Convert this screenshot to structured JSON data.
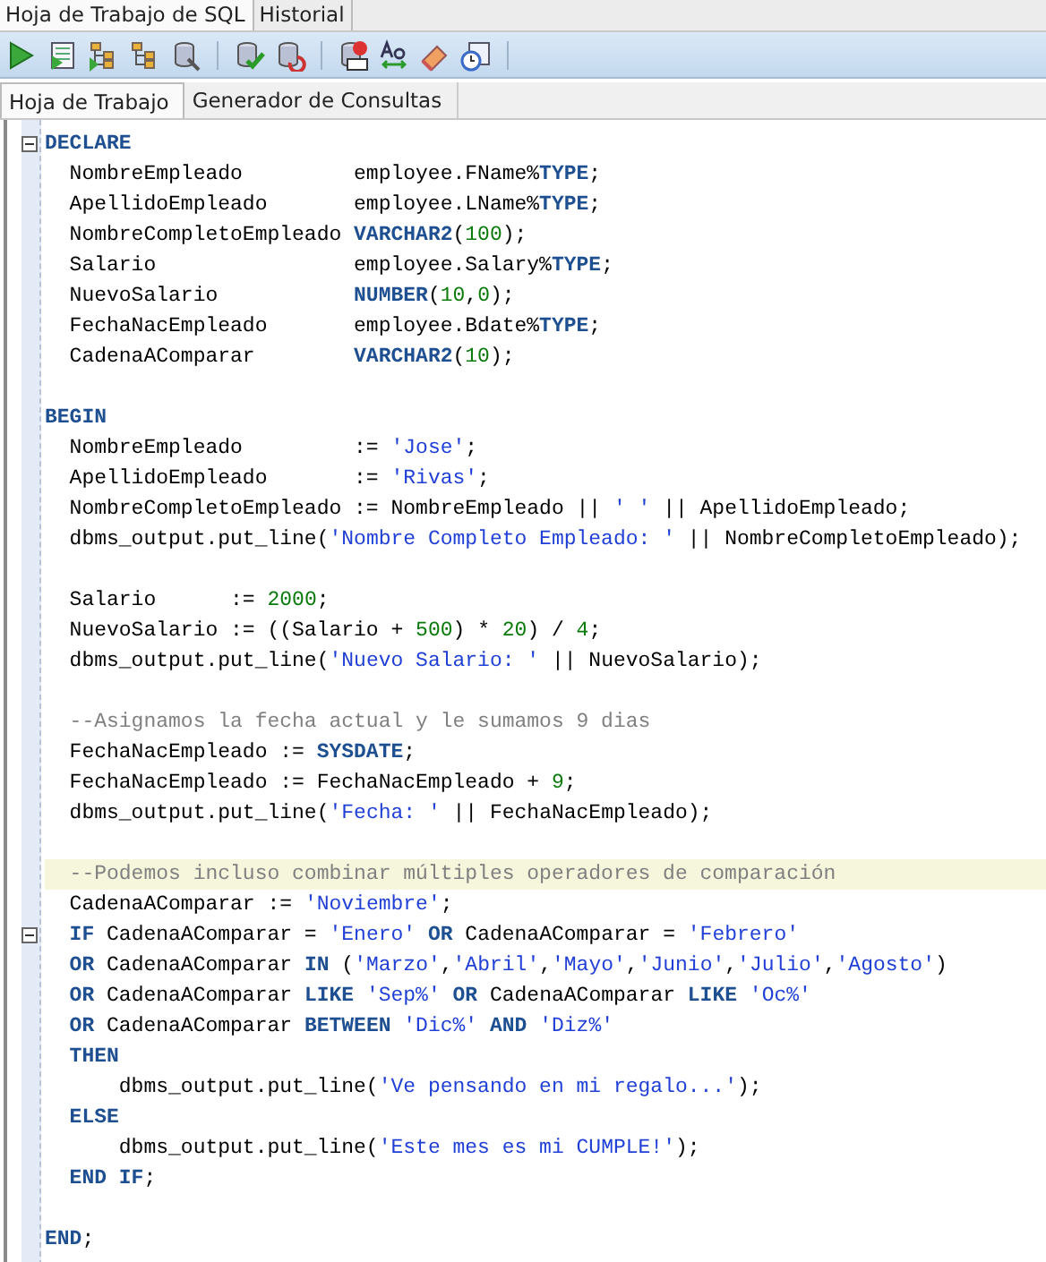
{
  "tabs": [
    {
      "label": "Hoja de Trabajo de SQL",
      "selected": true
    },
    {
      "label": "Historial",
      "selected": false
    }
  ],
  "subtabs": [
    {
      "label": "Hoja de Trabajo",
      "selected": true
    },
    {
      "label": "Generador de Consultas",
      "selected": false
    }
  ],
  "editor": {
    "lines": [
      {
        "kind": "code",
        "fold": true,
        "tokens": [
          {
            "kind": "keyword",
            "text": "DECLARE"
          }
        ]
      },
      {
        "kind": "code",
        "tokens": [
          {
            "kind": "plain",
            "text": "  NombreEmpleado         employee.FName%"
          },
          {
            "kind": "keyword",
            "text": "TYPE"
          },
          {
            "kind": "plain",
            "text": ";"
          }
        ]
      },
      {
        "kind": "code",
        "tokens": [
          {
            "kind": "plain",
            "text": "  ApellidoEmpleado       employee.LName%"
          },
          {
            "kind": "keyword",
            "text": "TYPE"
          },
          {
            "kind": "plain",
            "text": ";"
          }
        ]
      },
      {
        "kind": "code",
        "tokens": [
          {
            "kind": "plain",
            "text": "  NombreCompletoEmpleado "
          },
          {
            "kind": "keyword",
            "text": "VARCHAR2"
          },
          {
            "kind": "plain",
            "text": "("
          },
          {
            "kind": "number",
            "text": "100"
          },
          {
            "kind": "plain",
            "text": ");"
          }
        ]
      },
      {
        "kind": "code",
        "tokens": [
          {
            "kind": "plain",
            "text": "  Salario                employee.Salary%"
          },
          {
            "kind": "keyword",
            "text": "TYPE"
          },
          {
            "kind": "plain",
            "text": ";"
          }
        ]
      },
      {
        "kind": "code",
        "tokens": [
          {
            "kind": "plain",
            "text": "  NuevoSalario           "
          },
          {
            "kind": "keyword",
            "text": "NUMBER"
          },
          {
            "kind": "plain",
            "text": "("
          },
          {
            "kind": "number",
            "text": "10"
          },
          {
            "kind": "plain",
            "text": ","
          },
          {
            "kind": "number",
            "text": "0"
          },
          {
            "kind": "plain",
            "text": ");"
          }
        ]
      },
      {
        "kind": "code",
        "tokens": [
          {
            "kind": "plain",
            "text": "  FechaNacEmpleado       employee.Bdate%"
          },
          {
            "kind": "keyword",
            "text": "TYPE"
          },
          {
            "kind": "plain",
            "text": ";"
          }
        ]
      },
      {
        "kind": "code",
        "tokens": [
          {
            "kind": "plain",
            "text": "  CadenaAComparar        "
          },
          {
            "kind": "keyword",
            "text": "VARCHAR2"
          },
          {
            "kind": "plain",
            "text": "("
          },
          {
            "kind": "number",
            "text": "10"
          },
          {
            "kind": "plain",
            "text": ");"
          }
        ]
      },
      {
        "kind": "blank"
      },
      {
        "kind": "code",
        "tokens": [
          {
            "kind": "keyword",
            "text": "BEGIN"
          }
        ]
      },
      {
        "kind": "code",
        "tokens": [
          {
            "kind": "plain",
            "text": "  NombreEmpleado         := "
          },
          {
            "kind": "string",
            "text": "'Jose'"
          },
          {
            "kind": "plain",
            "text": ";"
          }
        ]
      },
      {
        "kind": "code",
        "tokens": [
          {
            "kind": "plain",
            "text": "  ApellidoEmpleado       := "
          },
          {
            "kind": "string",
            "text": "'Rivas'"
          },
          {
            "kind": "plain",
            "text": ";"
          }
        ]
      },
      {
        "kind": "code",
        "tokens": [
          {
            "kind": "plain",
            "text": "  NombreCompletoEmpleado := NombreEmpleado || "
          },
          {
            "kind": "string",
            "text": "' '"
          },
          {
            "kind": "plain",
            "text": " || ApellidoEmpleado;"
          }
        ]
      },
      {
        "kind": "code",
        "tokens": [
          {
            "kind": "plain",
            "text": "  dbms_output.put_line("
          },
          {
            "kind": "string",
            "text": "'Nombre Completo Empleado: '"
          },
          {
            "kind": "plain",
            "text": " || NombreCompletoEmpleado);"
          }
        ]
      },
      {
        "kind": "blank"
      },
      {
        "kind": "code",
        "tokens": [
          {
            "kind": "plain",
            "text": "  Salario      := "
          },
          {
            "kind": "number",
            "text": "2000"
          },
          {
            "kind": "plain",
            "text": ";"
          }
        ]
      },
      {
        "kind": "code",
        "tokens": [
          {
            "kind": "plain",
            "text": "  NuevoSalario := ((Salario + "
          },
          {
            "kind": "number",
            "text": "500"
          },
          {
            "kind": "plain",
            "text": ") * "
          },
          {
            "kind": "number",
            "text": "20"
          },
          {
            "kind": "plain",
            "text": ") / "
          },
          {
            "kind": "number",
            "text": "4"
          },
          {
            "kind": "plain",
            "text": ";"
          }
        ]
      },
      {
        "kind": "code",
        "tokens": [
          {
            "kind": "plain",
            "text": "  dbms_output.put_line("
          },
          {
            "kind": "string",
            "text": "'Nuevo Salario: '"
          },
          {
            "kind": "plain",
            "text": " || NuevoSalario);"
          }
        ]
      },
      {
        "kind": "blank"
      },
      {
        "kind": "code",
        "tokens": [
          {
            "kind": "comment",
            "text": "  --Asignamos la fecha actual y le sumamos 9 dias"
          }
        ]
      },
      {
        "kind": "code",
        "tokens": [
          {
            "kind": "plain",
            "text": "  FechaNacEmpleado := "
          },
          {
            "kind": "keyword",
            "text": "SYSDATE"
          },
          {
            "kind": "plain",
            "text": ";"
          }
        ]
      },
      {
        "kind": "code",
        "tokens": [
          {
            "kind": "plain",
            "text": "  FechaNacEmpleado := FechaNacEmpleado + "
          },
          {
            "kind": "number",
            "text": "9"
          },
          {
            "kind": "plain",
            "text": ";"
          }
        ]
      },
      {
        "kind": "code",
        "tokens": [
          {
            "kind": "plain",
            "text": "  dbms_output.put_line("
          },
          {
            "kind": "string",
            "text": "'Fecha: '"
          },
          {
            "kind": "plain",
            "text": " || FechaNacEmpleado);"
          }
        ]
      },
      {
        "kind": "blank"
      },
      {
        "kind": "code",
        "highlighted": true,
        "tokens": [
          {
            "kind": "comment",
            "text": "  --Podemos incluso combinar múltiples operadores de comparación"
          }
        ]
      },
      {
        "kind": "code",
        "tokens": [
          {
            "kind": "plain",
            "text": "  CadenaAComparar := "
          },
          {
            "kind": "string",
            "text": "'Noviembre'"
          },
          {
            "kind": "plain",
            "text": ";"
          }
        ]
      },
      {
        "kind": "code",
        "fold": true,
        "tokens": [
          {
            "kind": "keyword",
            "text": "  IF"
          },
          {
            "kind": "plain",
            "text": " CadenaAComparar = "
          },
          {
            "kind": "string",
            "text": "'Enero' "
          },
          {
            "kind": "keyword",
            "text": "OR"
          },
          {
            "kind": "plain",
            "text": " CadenaAComparar = "
          },
          {
            "kind": "string",
            "text": "'Febrero'"
          }
        ]
      },
      {
        "kind": "code",
        "tokens": [
          {
            "kind": "keyword",
            "text": "  OR"
          },
          {
            "kind": "plain",
            "text": " CadenaAComparar "
          },
          {
            "kind": "keyword",
            "text": "IN"
          },
          {
            "kind": "plain",
            "text": " ("
          },
          {
            "kind": "string",
            "text": "'Marzo'"
          },
          {
            "kind": "plain",
            "text": ","
          },
          {
            "kind": "string",
            "text": "'Abril'"
          },
          {
            "kind": "plain",
            "text": ","
          },
          {
            "kind": "string",
            "text": "'Mayo'"
          },
          {
            "kind": "plain",
            "text": ","
          },
          {
            "kind": "string",
            "text": "'Junio'"
          },
          {
            "kind": "plain",
            "text": ","
          },
          {
            "kind": "string",
            "text": "'Julio'"
          },
          {
            "kind": "plain",
            "text": ","
          },
          {
            "kind": "string",
            "text": "'Agosto'"
          },
          {
            "kind": "plain",
            "text": ")"
          }
        ]
      },
      {
        "kind": "code",
        "tokens": [
          {
            "kind": "keyword",
            "text": "  OR"
          },
          {
            "kind": "plain",
            "text": " CadenaAComparar "
          },
          {
            "kind": "keyword",
            "text": "LIKE"
          },
          {
            "kind": "string",
            "text": " 'Sep%' "
          },
          {
            "kind": "keyword",
            "text": "OR"
          },
          {
            "kind": "plain",
            "text": " CadenaAComparar "
          },
          {
            "kind": "keyword",
            "text": "LIKE"
          },
          {
            "kind": "string",
            "text": " 'Oc%'"
          }
        ]
      },
      {
        "kind": "code",
        "tokens": [
          {
            "kind": "keyword",
            "text": "  OR"
          },
          {
            "kind": "plain",
            "text": " CadenaAComparar "
          },
          {
            "kind": "keyword",
            "text": "BETWEEN"
          },
          {
            "kind": "string",
            "text": " 'Dic%' "
          },
          {
            "kind": "keyword",
            "text": "AND"
          },
          {
            "kind": "string",
            "text": " 'Diz%'"
          }
        ]
      },
      {
        "kind": "code",
        "tokens": [
          {
            "kind": "keyword",
            "text": "  THEN"
          }
        ]
      },
      {
        "kind": "code",
        "tokens": [
          {
            "kind": "plain",
            "text": "      dbms_output.put_line("
          },
          {
            "kind": "string",
            "text": "'Ve pensando en mi regalo...'"
          },
          {
            "kind": "plain",
            "text": ");"
          }
        ]
      },
      {
        "kind": "code",
        "tokens": [
          {
            "kind": "keyword",
            "text": "  ELSE"
          }
        ]
      },
      {
        "kind": "code",
        "tokens": [
          {
            "kind": "plain",
            "text": "      dbms_output.put_line("
          },
          {
            "kind": "string",
            "text": "'Este mes es mi CUMPLE!'"
          },
          {
            "kind": "plain",
            "text": ");"
          }
        ]
      },
      {
        "kind": "code",
        "tokens": [
          {
            "kind": "keyword",
            "text": "  END IF"
          },
          {
            "kind": "plain",
            "text": ";"
          }
        ]
      },
      {
        "kind": "blank"
      },
      {
        "kind": "code",
        "tokens": [
          {
            "kind": "keyword",
            "text": "END"
          },
          {
            "kind": "plain",
            "text": ";"
          }
        ]
      }
    ]
  }
}
